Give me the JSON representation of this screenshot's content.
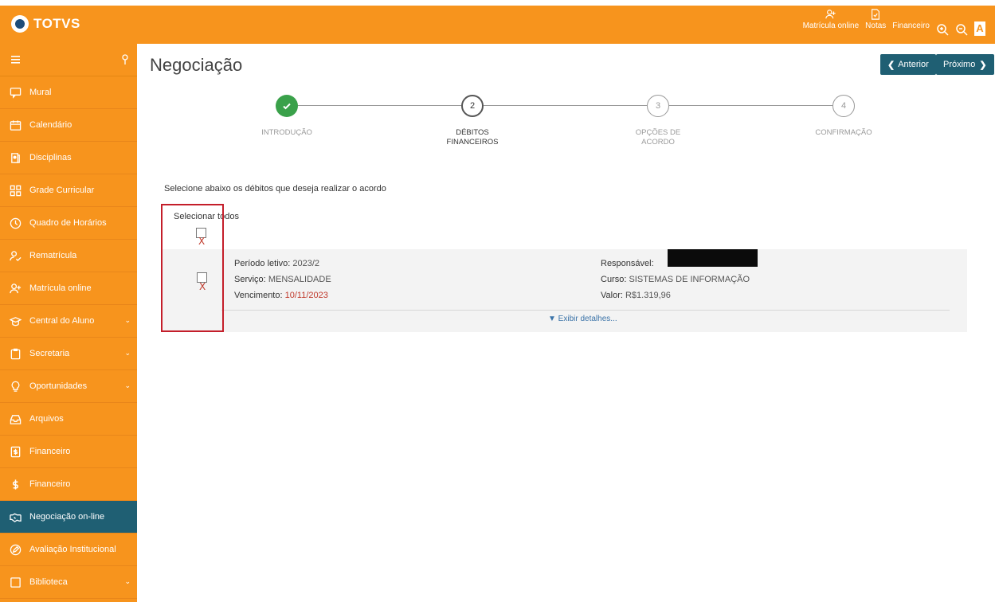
{
  "brand": {
    "logo_text": "TOTVS"
  },
  "topbar": {
    "actions": [
      {
        "label": "Matrícula online",
        "icon": "user-plus-icon"
      },
      {
        "label": "Notas",
        "icon": "document-check-icon"
      },
      {
        "label": "Financeiro",
        "icon": ""
      }
    ],
    "zoom_in_icon": "zoom-in-icon",
    "zoom_out_icon": "zoom-out-icon",
    "accessibility_label": "A"
  },
  "sidebar": {
    "items": [
      {
        "label": "Mural",
        "icon": "chat-icon",
        "expandable": false
      },
      {
        "label": "Calendário",
        "icon": "calendar-icon",
        "expandable": false
      },
      {
        "label": "Disciplinas",
        "icon": "book-icon",
        "expandable": false
      },
      {
        "label": "Grade Curricular",
        "icon": "grid-icon",
        "expandable": false
      },
      {
        "label": "Quadro de Horários",
        "icon": "clock-icon",
        "expandable": false
      },
      {
        "label": "Rematrícula",
        "icon": "user-check-icon",
        "expandable": false
      },
      {
        "label": "Matrícula online",
        "icon": "user-plus-icon",
        "expandable": false
      },
      {
        "label": "Central do Aluno",
        "icon": "graduation-icon",
        "expandable": true
      },
      {
        "label": "Secretaria",
        "icon": "clipboard-icon",
        "expandable": true
      },
      {
        "label": "Oportunidades",
        "icon": "lightbulb-icon",
        "expandable": true
      },
      {
        "label": "Arquivos",
        "icon": "inbox-icon",
        "expandable": false
      },
      {
        "label": "Financeiro",
        "icon": "document-dollar-icon",
        "expandable": false
      },
      {
        "label": "Financeiro",
        "icon": "dollar-icon",
        "expandable": false
      },
      {
        "label": "Negociação on-line",
        "icon": "handshake-icon",
        "expandable": false,
        "active": true
      },
      {
        "label": "Avaliação Institucional",
        "icon": "edit-icon",
        "expandable": false
      },
      {
        "label": "Biblioteca",
        "icon": "book-square-icon",
        "expandable": true
      }
    ]
  },
  "page": {
    "title": "Negociação",
    "prev_label": "Anterior",
    "next_label": "Próximo"
  },
  "stepper": {
    "steps": [
      {
        "number": "1",
        "label_line1": "INTRODUÇÃO",
        "label_line2": "",
        "state": "done"
      },
      {
        "number": "2",
        "label_line1": "DÉBITOS",
        "label_line2": "FINANCEIROS",
        "state": "current"
      },
      {
        "number": "3",
        "label_line1": "OPÇÕES DE",
        "label_line2": "ACORDO",
        "state": "todo"
      },
      {
        "number": "4",
        "label_line1": "CONFIRMAÇÃO",
        "label_line2": "",
        "state": "todo"
      }
    ]
  },
  "debts": {
    "instruction": "Selecione abaixo os débitos que deseja realizar o acordo",
    "select_all_label": "Selecionar todos",
    "x_mark": "X",
    "item": {
      "period_label": "Período letivo:",
      "period_value": "2023/2",
      "service_label": "Serviço:",
      "service_value": "MENSALIDADE",
      "due_label": "Vencimento:",
      "due_value": "10/11/2023",
      "responsible_label": "Responsável:",
      "course_label": "Curso:",
      "course_value": "SISTEMAS DE INFORMAÇÃO",
      "amount_label": "Valor:",
      "amount_value": "R$1.319,96",
      "details_link": "▼ Exibir detalhes..."
    }
  },
  "colors": {
    "brand_orange": "#f7941d",
    "active_teal": "#1f5f73",
    "success_green": "#3aa14a",
    "highlight_red": "#c41e2a"
  }
}
